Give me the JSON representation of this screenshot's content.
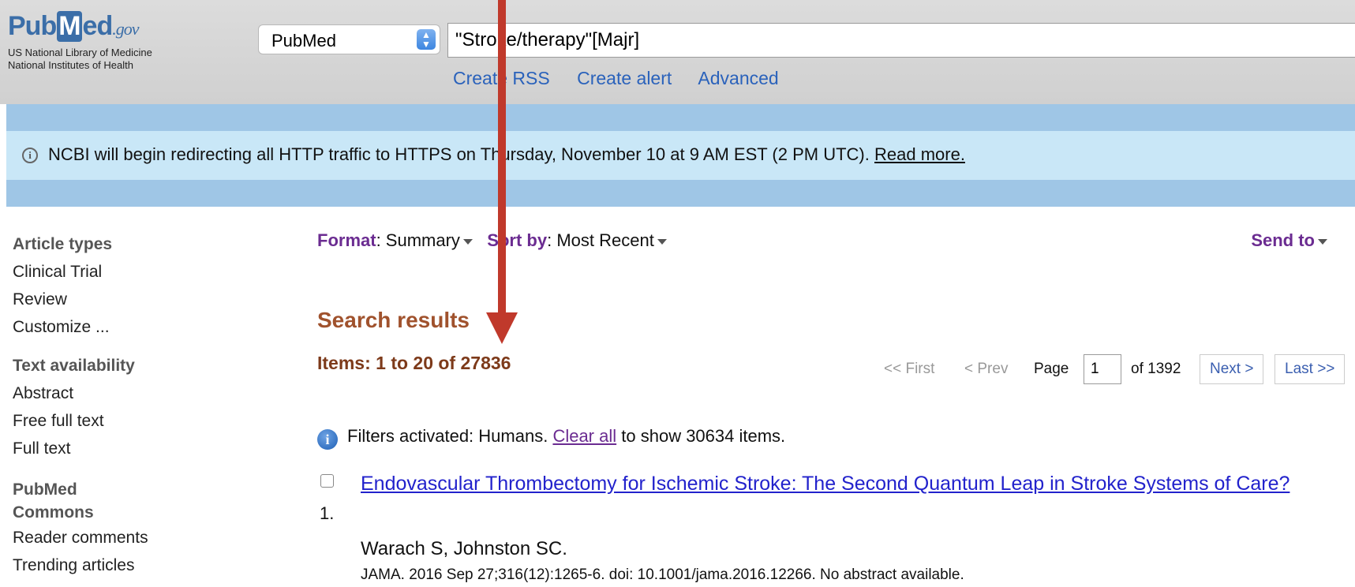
{
  "header": {
    "logo_word_left": "Pub",
    "logo_word_m": "M",
    "logo_word_right": "ed",
    "logo_gov": ".gov",
    "logo_line1": "US National Library of Medicine",
    "logo_line2": "National Institutes of Health",
    "database": "PubMed",
    "query": "\"Stroke/therapy\"[Majr]",
    "links": [
      "Create RSS",
      "Create alert",
      "Advanced"
    ]
  },
  "banner": {
    "text": "NCBI will begin redirecting all HTTP traffic to HTTPS on Thursday, November 10 at 9 AM EST (2 PM UTC).",
    "link": "Read more."
  },
  "sidebar": {
    "article_types": {
      "heading": "Article types",
      "items": [
        "Clinical Trial",
        "Review",
        "Customize ..."
      ]
    },
    "text_availability": {
      "heading": "Text availability",
      "items": [
        "Abstract",
        "Free full text",
        "Full text"
      ]
    },
    "commons": {
      "heading_line1": "PubMed",
      "heading_line2": "Commons",
      "items": [
        "Reader comments",
        "Trending articles"
      ]
    }
  },
  "toolbar": {
    "format_label": "Format",
    "format_value": "Summary",
    "sort_label": "Sort by",
    "sort_value": "Most Recent",
    "send_to": "Send to"
  },
  "results": {
    "title": "Search results",
    "items": "Items: 1 to 20 of 27836"
  },
  "pager": {
    "first": "<< First",
    "prev": "< Prev",
    "page_label": "Page",
    "page_value": "1",
    "of": "of 1392",
    "next": "Next >",
    "last": "Last >>"
  },
  "filters": {
    "prefix": "Filters activated: Humans.",
    "clear": "Clear all",
    "suffix": "to show 30634 items."
  },
  "result1": {
    "number": "1.",
    "title": "Endovascular Thrombectomy for Ischemic Stroke: The Second Quantum Leap in Stroke Systems of Care?",
    "authors": "Warach S, Johnston SC.",
    "journal": "JAMA. 2016 Sep 27;316(12):1265-6. doi: 10.1001/jama.2016.12266. No abstract available."
  },
  "colors": {
    "annotation_arrow": "#c0392b",
    "banner_bg": "#c9e7f7",
    "link_blue": "#2a62bb",
    "heading_brown": "#a0522d",
    "toolbar_purple": "#6b2c91"
  }
}
